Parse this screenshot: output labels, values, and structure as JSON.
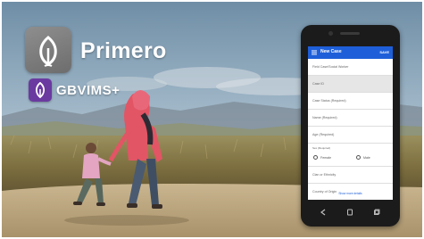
{
  "branding": {
    "app_name": "Primero",
    "module_name": "GBVIMS+",
    "primero_tile_icon": "leaf-icon",
    "gbv_tile_icon": "leaf-icon",
    "colors": {
      "gbv_purple": "#6b3aa0",
      "app_blue": "#1e5fd9"
    }
  },
  "phone": {
    "appbar": {
      "menu_icon": "menu-icon",
      "title": "New Case",
      "save_label": "SAVE"
    },
    "fields": [
      {
        "label": "Field Case/Social Worker"
      },
      {
        "label": "Case ID"
      },
      {
        "label": "Case Status (Required)"
      },
      {
        "label": "Name (Required)"
      },
      {
        "label": "Age (Required)"
      }
    ],
    "sex_field": {
      "label": "Sex (Required)",
      "options": [
        "Female",
        "Male"
      ]
    },
    "fields_after": [
      {
        "label": "Clan or Ethnicity"
      },
      {
        "label": "Country of Origin"
      }
    ],
    "show_more_label": "Show more details",
    "nav_icons": [
      "back-icon",
      "home-icon",
      "recent-apps-icon"
    ]
  }
}
